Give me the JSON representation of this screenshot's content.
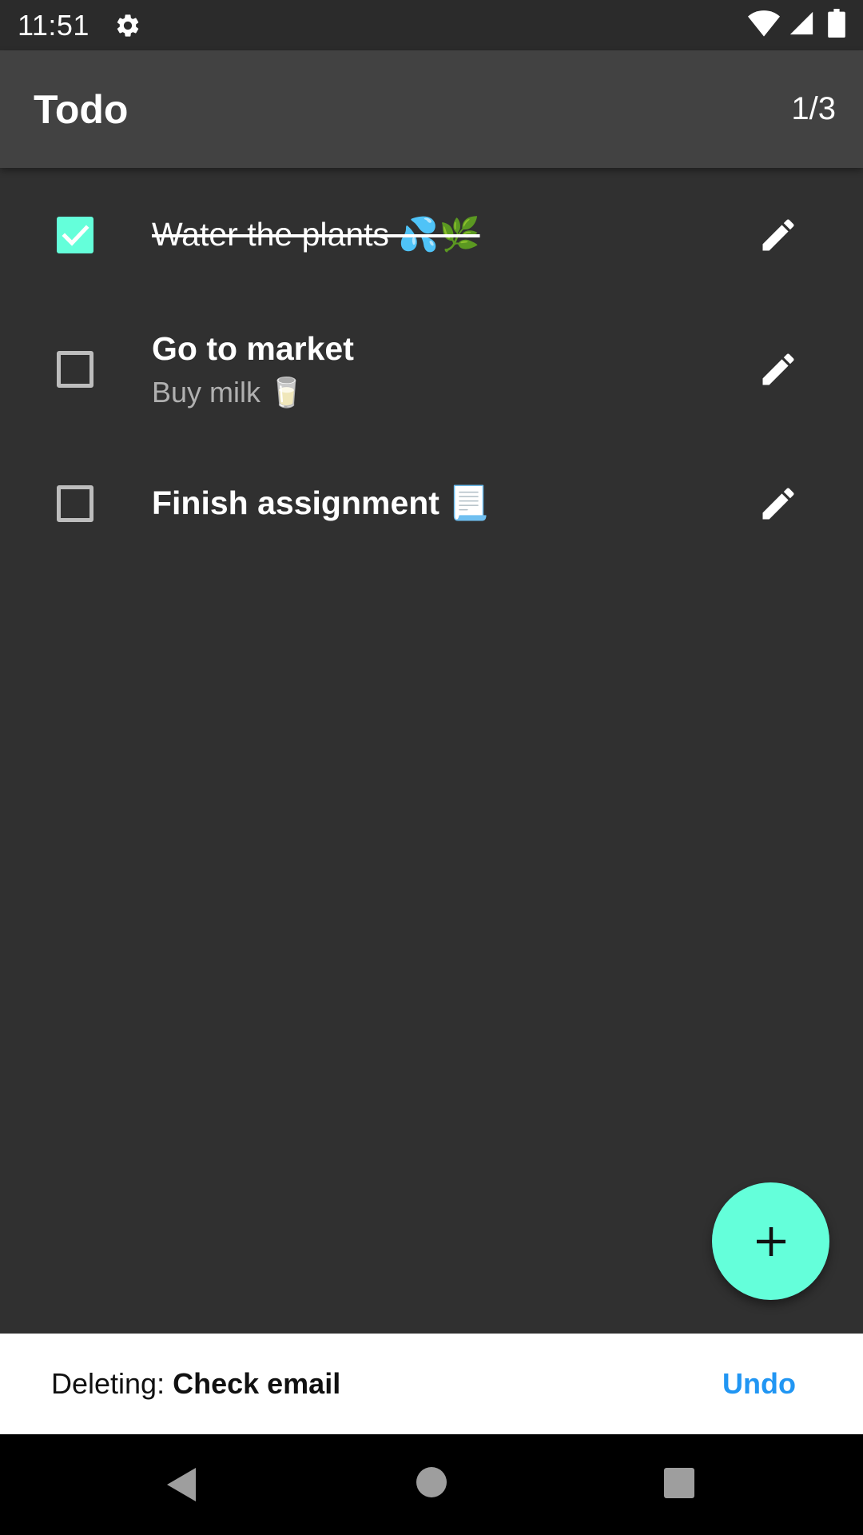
{
  "status_bar": {
    "time": "11:51",
    "icons": [
      "gear-icon",
      "wifi-icon",
      "signal-icon",
      "battery-icon"
    ]
  },
  "app_bar": {
    "title": "Todo",
    "count": "1/3"
  },
  "todos": [
    {
      "title": "Water the plants 💦🌿",
      "subtitle": "",
      "checked": true
    },
    {
      "title": "Go to market",
      "subtitle": "Buy milk 🥛",
      "checked": false
    },
    {
      "title": "Finish assignment 📃",
      "subtitle": "",
      "checked": false
    }
  ],
  "fab": {
    "icon": "plus-icon"
  },
  "snackbar": {
    "prefix": "Deleting:",
    "item": "Check email",
    "action": "Undo"
  },
  "nav": {
    "icons": [
      "back-icon",
      "home-icon",
      "recents-icon"
    ]
  },
  "colors": {
    "accent": "#64ffda",
    "background": "#303030",
    "app_bar": "#424242",
    "undo": "#2196f3"
  }
}
